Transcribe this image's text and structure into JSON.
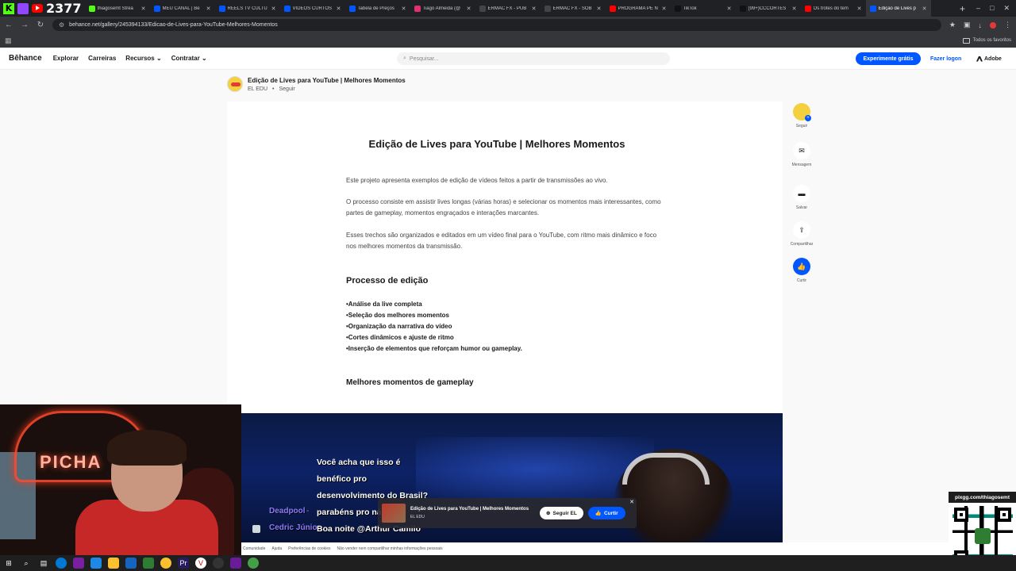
{
  "stream": {
    "viewer_count": "2377"
  },
  "browser": {
    "tabs": [
      {
        "title": "thiagosemt Strea",
        "color": "#53fc18"
      },
      {
        "title": "MEU CANAL | Be",
        "color": "#0057ff"
      },
      {
        "title": "REELS TV CULTU",
        "color": "#0057ff"
      },
      {
        "title": "VIDEOS CURTOS",
        "color": "#0057ff"
      },
      {
        "title": "Tabela de Preços",
        "color": "#0057ff"
      },
      {
        "title": "Tiago Almeida (@",
        "color": "#e1306c"
      },
      {
        "title": "ERMAC FX - PUB",
        "color": "#444444"
      },
      {
        "title": "ERMAC FX - SOB",
        "color": "#444444"
      },
      {
        "title": "PROGRAMA PÉ N",
        "color": "#ff0000"
      },
      {
        "title": "TikTok",
        "color": "#111111"
      },
      {
        "title": "(99+)CCCORTES",
        "color": "#111111"
      },
      {
        "title": "Os trotes do tem",
        "color": "#ff0000"
      },
      {
        "title": "Edição de Lives p",
        "color": "#0057ff"
      }
    ],
    "url": "behance.net/gallery/245394133/Edicao-de-Lives-para-YouTube-Melhores-Momentos",
    "bookmarks_label": "Todos os favoritos"
  },
  "header": {
    "logo": "Bēhance",
    "nav": [
      "Explorar",
      "Carreiras",
      "Recursos",
      "Contratar"
    ],
    "search_placeholder": "Pesquisar...",
    "trial_button": "Experimente grátis",
    "login_button": "Fazer logon",
    "adobe_label": "Adobe"
  },
  "project": {
    "title": "Edição de Lives para YouTube | Melhores Momentos",
    "owner": "EL EDU",
    "follow": "Seguir",
    "heading": "Edição de Lives para YouTube | Melhores Momentos",
    "paragraphs": [
      "Este projeto apresenta exemplos de edição de vídeos feitos a partir de transmissões ao vivo.",
      "O processo consiste em assistir lives longas (várias horas) e selecionar os momentos mais interessantes, como partes de gameplay, momentos engraçados e interações marcantes.",
      "Esses trechos são organizados e editados em um vídeo final para o YouTube, com ritmo mais dinâmico e foco nos melhores momentos da transmissão."
    ],
    "process_heading": "Processo de edição",
    "process_items": [
      "•Análise da live completa",
      "•Seleção dos melhores momentos",
      "•Organização da narrativa do vídeo",
      "•Cortes dinâmicos e ajuste de ritmo",
      "•Inserção de elementos que reforçam humor ou gameplay."
    ],
    "gameplay_heading": "Melhores momentos de gameplay"
  },
  "rail": {
    "follow": "Seguir",
    "message": "Mensagem",
    "save": "Salvar",
    "share": "Compartilhar",
    "like": "Curtir"
  },
  "video": {
    "captions": [
      "Você acha que isso é",
      "benéfico pro",
      "desenvolvimento do Brasil?",
      "parabéns pro nádo",
      "Boa noite @Arthur Camilo"
    ],
    "chat_users": [
      "Deadpool",
      "Cedric Júnior"
    ]
  },
  "floatbar": {
    "title": "Edição de Lives para YouTube | Melhores Momentos",
    "owner": "EL EDU",
    "follow": "Seguir EL",
    "like": "Curtir"
  },
  "footer": {
    "links": [
      "Comunidade",
      "Ajuda",
      "Preferências de cookies",
      "Não vender nem compartilhar minhas informações pessoais"
    ]
  },
  "webcam": {
    "neon": "PICHA"
  },
  "qr": {
    "label": "pixgg.com/thiagosemt"
  }
}
